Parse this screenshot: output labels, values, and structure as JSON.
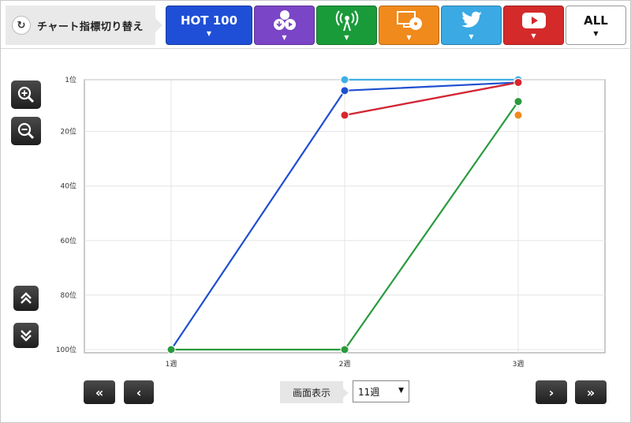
{
  "header": {
    "switch_label": "チャート指標切り替え",
    "tabs": [
      {
        "label": "HOT 100",
        "color": "#1f4fd6",
        "icon": "text"
      },
      {
        "label": "",
        "color": "#7a45c6",
        "icon": "download-stream-icon"
      },
      {
        "label": "",
        "color": "#1a9b3a",
        "icon": "radio-antenna-icon"
      },
      {
        "label": "",
        "color": "#f08a1c",
        "icon": "pc-cd-icon"
      },
      {
        "label": "",
        "color": "#3aa9e4",
        "icon": "twitter-bird-icon"
      },
      {
        "label": "",
        "color": "#d42a2a",
        "icon": "youtube-play-icon"
      },
      {
        "label": "ALL",
        "color": "#ffffff",
        "icon": "text"
      }
    ]
  },
  "controls": {
    "zoom_in_icon": "zoom-in-icon",
    "zoom_out_icon": "zoom-out-icon",
    "page_up_icon": "double-chevron-up-icon",
    "page_down_icon": "double-chevron-down-icon",
    "first_label": "«",
    "prev_label": "‹",
    "next_label": "›",
    "last_label": "»",
    "display_label": "画面表示",
    "display_value": "11週"
  },
  "chart_data": {
    "type": "line",
    "x_labels": [
      "1週",
      "2週",
      "3週"
    ],
    "y_ticks": [
      1,
      20,
      40,
      60,
      80,
      100
    ],
    "y_tick_labels": [
      "1位",
      "20位",
      "40位",
      "60位",
      "80位",
      "100位"
    ],
    "ylim": [
      1,
      100
    ],
    "y_inverted": true,
    "grid": true,
    "series": [
      {
        "color": "#1d4fd0",
        "values": [
          100,
          5,
          2
        ]
      },
      {
        "color": "#2a9a3e",
        "values": [
          100,
          100,
          9
        ]
      },
      {
        "color": "#41aee2",
        "values": [
          null,
          1,
          1
        ]
      },
      {
        "color": "#7a47c9",
        "values": [
          null,
          14,
          2
        ]
      },
      {
        "color": "#d8262c",
        "values": [
          null,
          14,
          2
        ]
      },
      {
        "color": "#f08a1c",
        "values": [
          null,
          null,
          14
        ]
      }
    ]
  }
}
